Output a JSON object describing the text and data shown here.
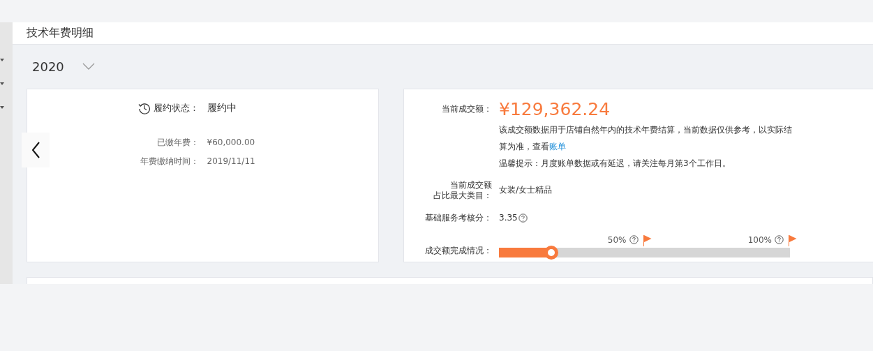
{
  "header": {
    "title": "技术年费明细"
  },
  "year_select": {
    "value": "2020"
  },
  "contract_card": {
    "status_label": "履约状态：",
    "status_value": "履约中",
    "rows": [
      {
        "label": "已缴年费：",
        "value": "¥60,000.00"
      },
      {
        "label": "年费缴纳时间：",
        "value": "2019/11/11"
      }
    ]
  },
  "sales_card": {
    "amount_label": "当前成交额：",
    "amount": "¥129,362.24",
    "note": "该成交额数据用于店铺自然年内的技术年费结算，当前数据仅供参考，以实际结算为准，查看",
    "note_link": "账单",
    "tip": "温馨提示：月度账单数据或有延迟，请关注每月第3个工作日。",
    "category_label": [
      "当前成交额",
      "占比最大类目："
    ],
    "category_value": "女装/女士精品",
    "score_label": "基础服务考核分：",
    "score_value": "3.35",
    "progress": {
      "label": "成交额完成情况：",
      "level": 0.18,
      "markers": [
        {
          "label": "50%"
        },
        {
          "label": "100%"
        }
      ]
    }
  }
}
